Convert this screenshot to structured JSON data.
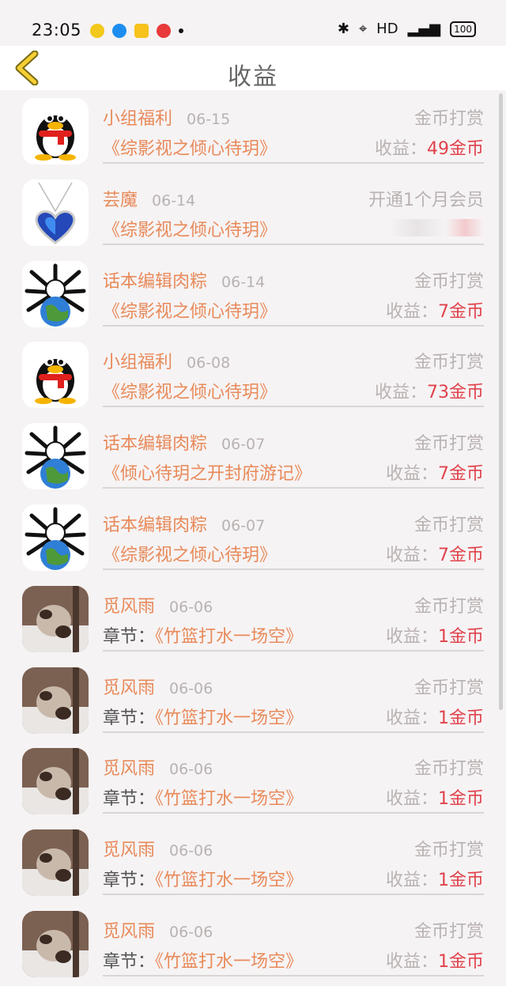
{
  "status_bar": {
    "time": "23:05",
    "network": "HD",
    "battery": "100"
  },
  "header": {
    "title": "收益"
  },
  "colors": {
    "accent": "#e88a5a",
    "amount": "#e0434c",
    "muted": "#b9b2b2"
  },
  "rows": [
    {
      "avatar": "qq-penguin",
      "name": "小组福利",
      "date": "06-15",
      "type": "金币打赏",
      "prefix": "",
      "book": "《综影视之倾心待玥》",
      "earn_label": "收益：",
      "amount": "49金币"
    },
    {
      "avatar": "heart-necklace",
      "name": "芸魔",
      "date": "06-14",
      "type": "开通1个月会员",
      "prefix": "",
      "book": "《综影视之倾心待玥》",
      "earn_label": "",
      "amount": ""
    },
    {
      "avatar": "bone-earth",
      "name": "话本编辑肉粽",
      "date": "06-14",
      "type": "金币打赏",
      "prefix": "",
      "book": "《综影视之倾心待玥》",
      "earn_label": "收益：",
      "amount": "7金币"
    },
    {
      "avatar": "qq-penguin",
      "name": "小组福利",
      "date": "06-08",
      "type": "金币打赏",
      "prefix": "",
      "book": "《综影视之倾心待玥》",
      "earn_label": "收益：",
      "amount": "73金币"
    },
    {
      "avatar": "bone-earth",
      "name": "话本编辑肉粽",
      "date": "06-07",
      "type": "金币打赏",
      "prefix": "",
      "book": "《倾心待玥之开封府游记》",
      "earn_label": "收益：",
      "amount": "7金币"
    },
    {
      "avatar": "bone-earth",
      "name": "话本编辑肉粽",
      "date": "06-07",
      "type": "金币打赏",
      "prefix": "",
      "book": "《综影视之倾心待玥》",
      "earn_label": "收益：",
      "amount": "7金币"
    },
    {
      "avatar": "panda-photo",
      "name": "觅风雨",
      "date": "06-06",
      "type": "金币打赏",
      "prefix": "章节：",
      "book": "《竹篮打水一场空》",
      "earn_label": "收益：",
      "amount": "1金币"
    },
    {
      "avatar": "panda-photo",
      "name": "觅风雨",
      "date": "06-06",
      "type": "金币打赏",
      "prefix": "章节：",
      "book": "《竹篮打水一场空》",
      "earn_label": "收益：",
      "amount": "1金币"
    },
    {
      "avatar": "panda-photo",
      "name": "觅风雨",
      "date": "06-06",
      "type": "金币打赏",
      "prefix": "章节：",
      "book": "《竹篮打水一场空》",
      "earn_label": "收益：",
      "amount": "1金币"
    },
    {
      "avatar": "panda-photo",
      "name": "觅风雨",
      "date": "06-06",
      "type": "金币打赏",
      "prefix": "章节：",
      "book": "《竹篮打水一场空》",
      "earn_label": "收益：",
      "amount": "1金币"
    },
    {
      "avatar": "panda-photo",
      "name": "觅风雨",
      "date": "06-06",
      "type": "金币打赏",
      "prefix": "章节：",
      "book": "《竹篮打水一场空》",
      "earn_label": "收益：",
      "amount": "1金币"
    }
  ]
}
